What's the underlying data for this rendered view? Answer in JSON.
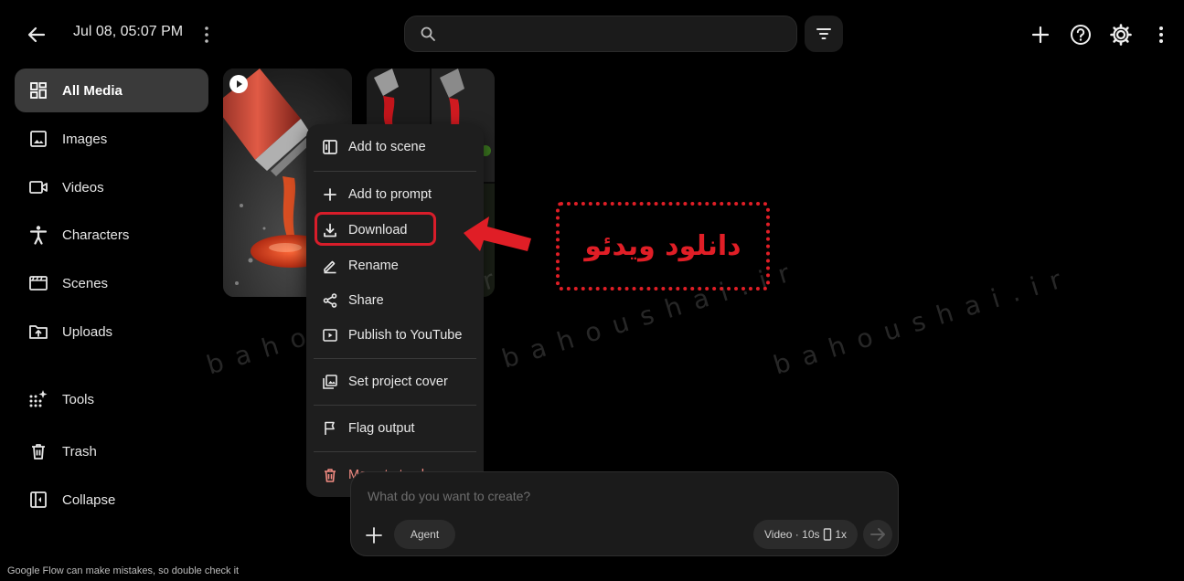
{
  "header": {
    "title": "Jul 08, 05:07 PM",
    "search_placeholder": ""
  },
  "sidebar": {
    "items": [
      {
        "label": "All Media",
        "icon": "grid-icon",
        "active": true
      },
      {
        "label": "Images",
        "icon": "image-icon"
      },
      {
        "label": "Videos",
        "icon": "video-icon"
      },
      {
        "label": "Characters",
        "icon": "person-icon"
      },
      {
        "label": "Scenes",
        "icon": "clapper-icon"
      },
      {
        "label": "Uploads",
        "icon": "upload-folder-icon"
      },
      {
        "label": "Tools",
        "icon": "sparkle-grid-icon"
      },
      {
        "label": "Trash",
        "icon": "trash-icon"
      },
      {
        "label": "Collapse",
        "icon": "collapse-panel-icon"
      }
    ]
  },
  "menu": {
    "items": [
      {
        "label": "Add to scene",
        "icon": "add-to-scene-icon"
      },
      {
        "label": "Add to prompt",
        "icon": "plus-icon"
      },
      {
        "label": "Download",
        "icon": "download-icon"
      },
      {
        "label": "Rename",
        "icon": "pencil-icon"
      },
      {
        "label": "Share",
        "icon": "share-icon"
      },
      {
        "label": "Publish to YouTube",
        "icon": "youtube-play-icon"
      },
      {
        "label": "Set project cover",
        "icon": "gallery-icon"
      },
      {
        "label": "Flag output",
        "icon": "flag-icon"
      },
      {
        "label": "Move to trash",
        "icon": "trash-icon",
        "danger": true
      }
    ]
  },
  "annotation": {
    "text": "دانلود ویدئو",
    "color": "#e01e26"
  },
  "watermark": "bahoushai.ir",
  "prompt": {
    "placeholder": "What do you want to create?",
    "agent_label": "Agent",
    "mode_label": "Video · 10s",
    "multiplier_label": "1x"
  },
  "footer": {
    "disclaimer": "Google Flow can make mistakes, so double check it"
  },
  "colors": {
    "background": "#000000",
    "active_item": "#3a3a3a",
    "danger": "#f28b82",
    "highlight": "#d81d2a"
  }
}
